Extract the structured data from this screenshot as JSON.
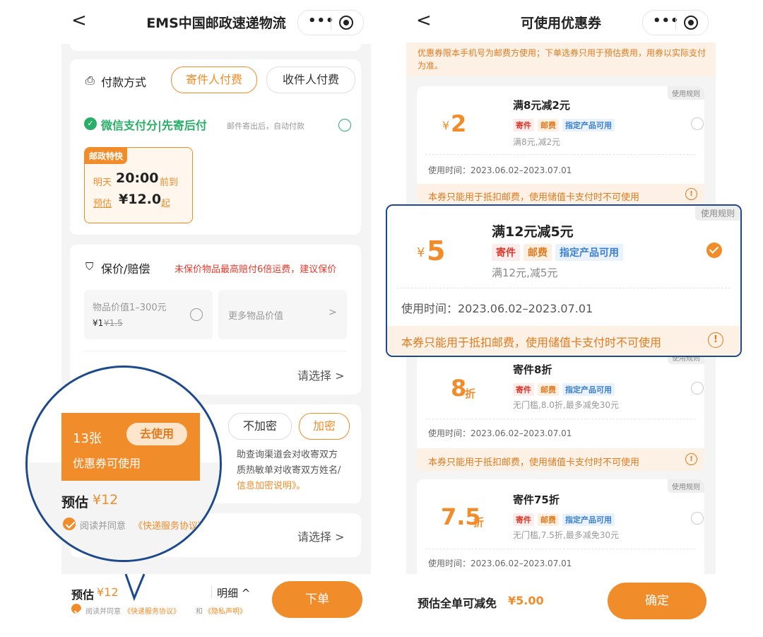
{
  "left": {
    "nav": {
      "back": "<",
      "title": "EMS中国邮政速递物流",
      "dots": "•••"
    },
    "payment": {
      "label": "付款方式",
      "sender_pays": "寄件人付费",
      "receiver_pays": "收件人付费",
      "wechat": "微信支付分|先寄后付",
      "wechat_note": "邮件寄出后，自动付款",
      "product": {
        "badge": "邮政特快",
        "day": "明天",
        "time": "20:00",
        "arrive": "前到",
        "est": "预估",
        "price": "¥12.0",
        "from": "起"
      }
    },
    "insurance": {
      "label": "保价/赔偿",
      "warning": "未保价物品最高赔付6倍运费，建议保价",
      "opt1_label": "物品价值1–300元",
      "opt1_price": "¥1",
      "opt1_old": "¥1.5",
      "opt2_label": "更多物品价值",
      "opt2_arrow": ">"
    },
    "select_row1": "请选择 >",
    "privacy": {
      "no_encrypt": "不加密",
      "encrypt": "加密",
      "line1": "助查询渠道会对收寄双方",
      "line2": "质热敏单对收寄双方姓名/",
      "line3": "信息加密说明》。"
    },
    "select_row2": "请选择 >",
    "bottom": {
      "est": "预估",
      "price": "¥12",
      "detail": "明细 ^",
      "order": "下单",
      "agree": "阅读并同意",
      "service": "《快递服务协议》",
      "and": "和",
      "privacy": "《隐私声明》"
    },
    "zoom": {
      "count": "13张",
      "use": "去使用",
      "available": "优惠券可使用",
      "est": "预估",
      "price": "¥12",
      "agree": "阅读并同意",
      "service": "《快递服务协议》",
      "tail": "和"
    }
  },
  "right": {
    "nav": {
      "back": "<",
      "title": "可使用优惠券",
      "dots": "•••"
    },
    "notice": "优惠券限本手机号为邮费方使用；下单选券只用于预估费用，用券以实际支付为准。",
    "coupons": [
      {
        "amount": "2",
        "prefix": "¥",
        "suffix": "",
        "title": "满8元减2元",
        "tags": [
          "寄件",
          "邮费",
          "指定产品可用"
        ],
        "desc": "满8元,减2元",
        "time": "使用时间：2023.06.02–2023.07.01",
        "note": "本券只能用于抵扣邮费，使用储值卡支付时不可使用",
        "rule": "使用规则",
        "warn": "!"
      },
      {
        "amount": "5",
        "prefix": "¥",
        "suffix": "",
        "title": "满12元减5元",
        "tags": [
          "寄件",
          "邮费",
          "指定产品可用"
        ],
        "desc": "满12元,减5元",
        "time": "使用时间：2023.06.02–2023.07.01",
        "note": "本券只能用于抵扣邮费，使用储值卡支付时不可使用",
        "rule": "使用规则",
        "warn": "!"
      },
      {
        "amount": "8",
        "prefix": "",
        "suffix": "折",
        "title": "寄件8折",
        "tags": [
          "寄件",
          "邮费",
          "指定产品可用"
        ],
        "desc": "无门槛,8.0折,最多减免30元",
        "time": "使用时间：2023.06.02–2023.07.01",
        "note": "本券只能用于抵扣邮费，使用储值卡支付时不可使用",
        "rule": "使用规则",
        "warn": "!"
      },
      {
        "amount": "7.5",
        "prefix": "",
        "suffix": "折",
        "title": "寄件75折",
        "tags": [
          "寄件",
          "邮费",
          "指定产品可用"
        ],
        "desc": "无门槛,7.5折,最多减免30元",
        "time": "使用时间：2023.06.02–2023.07.01",
        "rule": "使用规则"
      }
    ],
    "bottom": {
      "label": "预估全单可减免",
      "amount": "¥5.00",
      "confirm": "确定"
    }
  },
  "colors": {
    "accent": "#f08c2a",
    "zoom_border": "#1c4a8c",
    "wechat_green": "#2aae67",
    "warning_red": "#e8392c"
  }
}
